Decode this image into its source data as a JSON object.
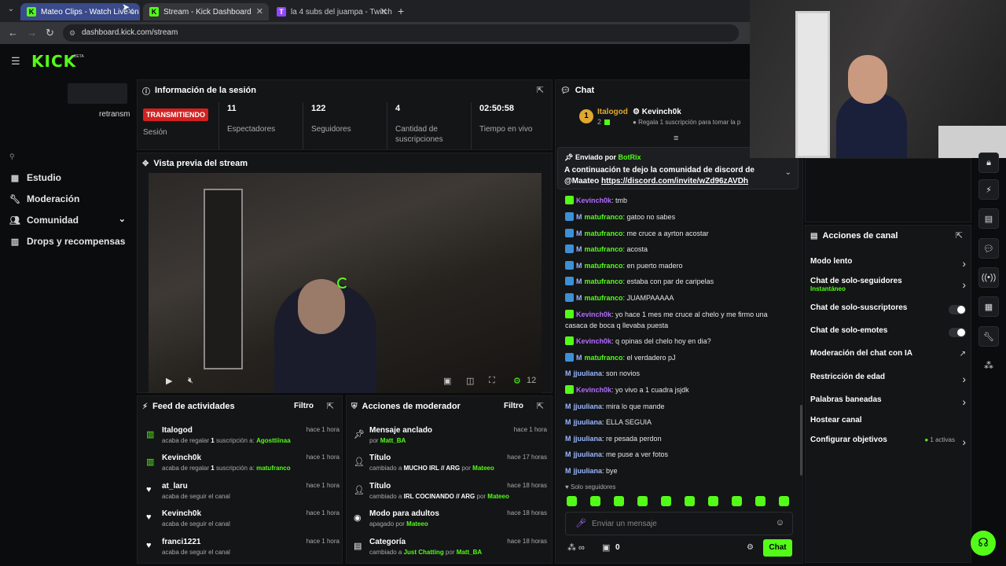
{
  "browser": {
    "tabs": [
      {
        "title": "Mateo Clips - Watch Live on Kick",
        "active": true,
        "favicon": "K"
      },
      {
        "title": "Stream - Kick Dashboard",
        "active": false,
        "favicon": "K"
      },
      {
        "title": "la 4 subs del juampa - Twitch",
        "active": false,
        "favicon": "T"
      }
    ],
    "url": "dashboard.kick.com/stream"
  },
  "brand": {
    "logo": "KICK",
    "beta": "BETA"
  },
  "sidebar": {
    "partial_text": "retransm",
    "items": [
      {
        "label": "Estudio",
        "icon": "grid-icon"
      },
      {
        "label": "Moderación",
        "icon": "wrench-icon"
      },
      {
        "label": "Comunidad",
        "icon": "users-icon"
      },
      {
        "label": "Drops y recompensas",
        "icon": "gift-icon"
      }
    ]
  },
  "session": {
    "title": "Información de la sesión",
    "status": "TRANSMITIENDO",
    "status_label": "Sesión",
    "viewers": "11",
    "viewers_label": "Espectadores",
    "followers": "122",
    "followers_label": "Seguidores",
    "subs": "4",
    "subs_label": "Cantidad de suscripciones",
    "uptime": "02:50:58",
    "uptime_label": "Tiempo en vivo"
  },
  "preview": {
    "title": "Vista previa del stream",
    "viewer_count": "12"
  },
  "feed": {
    "title": "Feed de actividades",
    "filter": "Filtro",
    "items": [
      {
        "name": "Italogod",
        "pre": "acaba de regalar ",
        "count": "1",
        "mid": " suscripción a: ",
        "target": "Agosttiinaa",
        "time": "hace 1 hora",
        "icon": "gift-icon"
      },
      {
        "name": "Kevinch0k",
        "pre": "acaba de regalar ",
        "count": "1",
        "mid": " suscripción a: ",
        "target": "matufranco",
        "time": "hace 1 hora",
        "icon": "gift-icon"
      },
      {
        "name": "at_laru",
        "text": "acaba de seguir el canal",
        "time": "hace 1 hora",
        "icon": "heart-icon"
      },
      {
        "name": "Kevinch0k",
        "text": "acaba de seguir el canal",
        "time": "hace 1 hora",
        "icon": "heart-icon"
      },
      {
        "name": "franci1221",
        "text": "acaba de seguir el canal",
        "time": "hace 1 hora",
        "icon": "heart-icon"
      }
    ]
  },
  "mod_actions": {
    "title": "Acciones de moderador",
    "filter": "Filtro",
    "items": [
      {
        "name": "Mensaje anclado",
        "pre": "por ",
        "value": "Matt_BA",
        "time": "hace 1 hora",
        "icon": "pin-icon"
      },
      {
        "name": "Título",
        "pre": "cambiado a ",
        "value": "MUCHO IRL // ARG",
        "mid": " por ",
        "by": "Mateeo",
        "time": "hace 17 horas",
        "icon": "user-edit-icon"
      },
      {
        "name": "Título",
        "pre": "cambiado a ",
        "value": "IRL COCINANDO // ARG",
        "mid": " por ",
        "by": "Mateeo",
        "time": "hace 18 horas",
        "icon": "user-edit-icon"
      },
      {
        "name": "Modo para adultos",
        "pre": "apagado por ",
        "value": "Mateeo",
        "time": "hace 18 horas",
        "icon": "eye-icon"
      },
      {
        "name": "Categoría",
        "pre": "cambiado a ",
        "value": "Just Chatting",
        "mid": " por ",
        "by": "Matt_BA",
        "time": "hace 18 horas",
        "icon": "category-icon"
      }
    ]
  },
  "chat": {
    "title": "Chat",
    "top_gifter": {
      "rank": "1",
      "name": "Italogod",
      "count": "2"
    },
    "event_user": "Kevinch0k",
    "event_text": "Regala 1 suscripción para tomar la p",
    "pinned": {
      "sent_by_label": "Enviado por",
      "sender": "BotRix",
      "text": "A continuación te dejo la comunidad de discord de",
      "text2": "@Maateo ",
      "link": "https://discord.com/invite/wZd96zAVDh"
    },
    "messages": [
      {
        "user": "Kevinch0k",
        "text": ": tmb",
        "color": "p",
        "badges": "g"
      },
      {
        "user": "matufranco",
        "text": ": gatoo no sabes",
        "color": "g",
        "badges": "bm"
      },
      {
        "user": "matufranco",
        "text": ": me cruce a ayrton acostar",
        "color": "g",
        "badges": "bm"
      },
      {
        "user": "matufranco",
        "text": ": acosta",
        "color": "g",
        "badges": "bm"
      },
      {
        "user": "matufranco",
        "text": ": en puerto madero",
        "color": "g",
        "badges": "bm"
      },
      {
        "user": "matufranco",
        "text": ": estaba con par de caripelas",
        "color": "g",
        "badges": "bm"
      },
      {
        "user": "matufranco",
        "text": ": JUAMPAAAAA",
        "color": "g",
        "badges": "bm"
      },
      {
        "user": "Kevinch0k",
        "text": ": yo hace 1 mes me cruce al chelo y me firmo una",
        "text2": "casaca de boca q llevaba puesta",
        "color": "p",
        "badges": "g"
      },
      {
        "user": "Kevinch0k",
        "text": ": q opinas del chelo hoy en dia?",
        "color": "p",
        "badges": "g"
      },
      {
        "user": "matufranco",
        "text": ": el verdadero pJ",
        "color": "g",
        "badges": "bm"
      },
      {
        "user": "jjuuliana",
        "text": ": son novios",
        "color": "b",
        "badges": "m"
      },
      {
        "user": "Kevinch0k",
        "text": ": yo vivo a 1 cuadra jsjdk",
        "color": "p",
        "badges": "g"
      },
      {
        "user": "jjuuliana",
        "text": ": mira lo que mande",
        "color": "b",
        "badges": "m"
      },
      {
        "user": "jjuuliana",
        "text": ": ELLA SEGUIA",
        "color": "b",
        "badges": "m"
      },
      {
        "user": "jjuuliana",
        "text": ": re pesada perdon",
        "color": "b",
        "badges": "m"
      },
      {
        "user": "jjuuliana",
        "text": ": me puse a ver fotos",
        "color": "b",
        "badges": "m"
      },
      {
        "user": "jjuuliana",
        "text": ": bye",
        "color": "b",
        "badges": "m"
      }
    ],
    "followers_only": "Solo seguidores",
    "input_placeholder": "Enviar un mensaje",
    "points": "0",
    "send_label": "Chat"
  },
  "channel_actions": {
    "title": "Acciones de canal",
    "items": [
      {
        "label": "Modo lento",
        "kind": "chevron"
      },
      {
        "label": "Chat de solo-seguidores",
        "sub": "Instantáneo",
        "kind": "chevron"
      },
      {
        "label": "Chat de solo-suscriptores",
        "kind": "toggle"
      },
      {
        "label": "Chat de solo-emotes",
        "kind": "toggle"
      },
      {
        "label": "Moderación del chat con IA",
        "kind": "external"
      },
      {
        "label": "Restricción de edad",
        "kind": "chevron"
      },
      {
        "label": "Palabras baneadas",
        "kind": "chevron"
      },
      {
        "label": "Hostear canal",
        "kind": "none"
      },
      {
        "label": "Configurar objetivos",
        "extra": "1 activas",
        "kind": "chevron"
      }
    ]
  },
  "colors": {
    "accent": "#53fc18",
    "live": "#d32121",
    "panel": "#141517"
  }
}
